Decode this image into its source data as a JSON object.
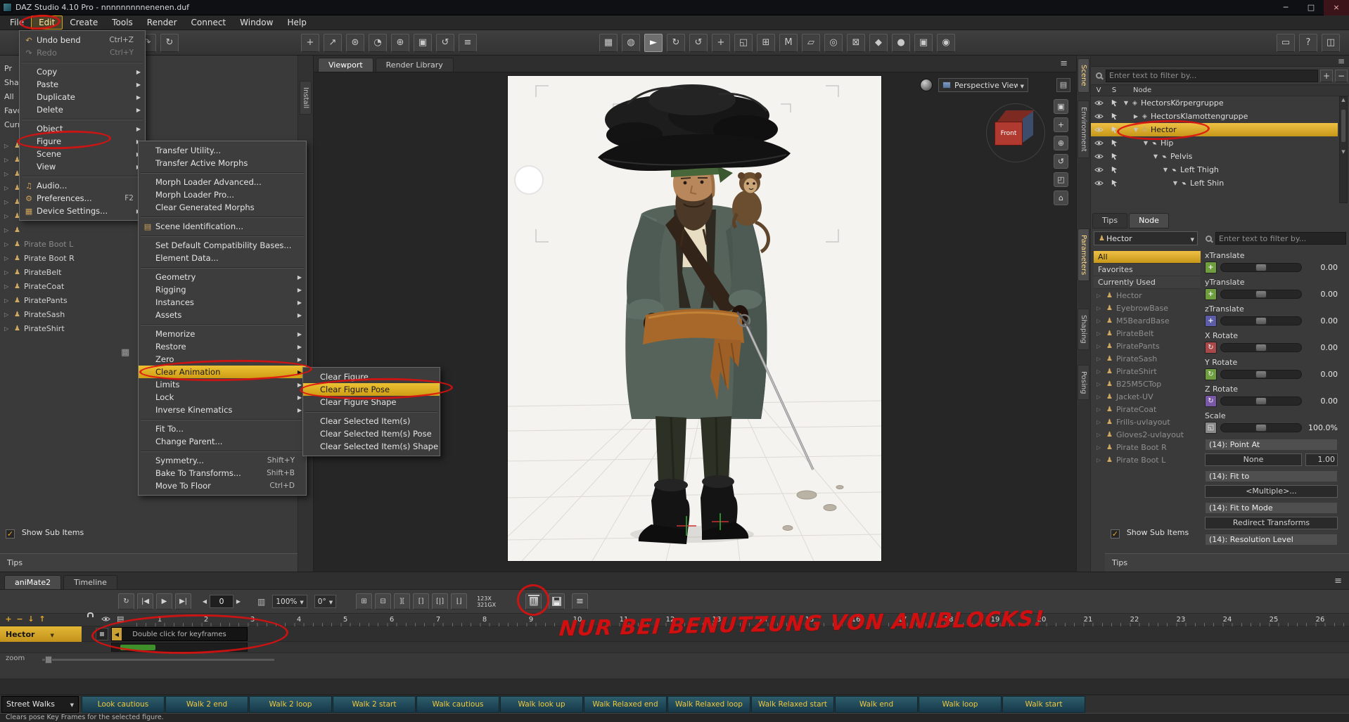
{
  "window": {
    "title": "DAZ Studio 4.10 Pro - nnnnnnnnnenenen.duf",
    "minimize": "─",
    "maximize": "□",
    "close": "×"
  },
  "menu_bar": {
    "items": [
      {
        "label": "File"
      },
      {
        "label": "Edit",
        "active": true
      },
      {
        "label": "Create"
      },
      {
        "label": "Tools"
      },
      {
        "label": "Render"
      },
      {
        "label": "Connect"
      },
      {
        "label": "Window"
      },
      {
        "label": "Help"
      }
    ]
  },
  "edit_menu": {
    "items": [
      {
        "label": "Undo bend",
        "shortcut": "Ctrl+Z",
        "icon": "↶"
      },
      {
        "label": "Redo",
        "shortcut": "Ctrl+Y",
        "icon": "↷",
        "disabled": true
      },
      {
        "label": "Copy",
        "submenu": true,
        "sep": true
      },
      {
        "label": "Paste",
        "submenu": true
      },
      {
        "label": "Duplicate",
        "submenu": true
      },
      {
        "label": "Delete",
        "submenu": true
      },
      {
        "label": "Object",
        "submenu": true,
        "sep": true
      },
      {
        "label": "Figure",
        "submenu": true
      },
      {
        "label": "Scene",
        "submenu": true
      },
      {
        "label": "View",
        "submenu": true
      },
      {
        "label": "Audio...",
        "icon": "♫",
        "sep": true
      },
      {
        "label": "Preferences...",
        "shortcut": "F2",
        "icon": "⚙"
      },
      {
        "label": "Device Settings...",
        "submenu": true,
        "icon": "▦"
      }
    ]
  },
  "figure_menu": {
    "items": [
      {
        "label": "Transfer Utility..."
      },
      {
        "label": "Transfer Active Morphs"
      },
      {
        "label": "Morph Loader Advanced...",
        "sep": true
      },
      {
        "label": "Morph Loader Pro..."
      },
      {
        "label": "Clear Generated Morphs"
      },
      {
        "label": "Scene Identification...",
        "icon": "▤",
        "sep": true
      },
      {
        "label": "Set Default Compatibility Bases...",
        "sep": true
      },
      {
        "label": "Element Data..."
      },
      {
        "label": "Geometry",
        "submenu": true,
        "sep": true
      },
      {
        "label": "Rigging",
        "submenu": true
      },
      {
        "label": "Instances",
        "submenu": true
      },
      {
        "label": "Assets",
        "submenu": true
      },
      {
        "label": "Memorize",
        "submenu": true,
        "sep": true
      },
      {
        "label": "Restore",
        "submenu": true
      },
      {
        "label": "Zero",
        "submenu": true
      },
      {
        "label": "Clear Animation",
        "submenu": true,
        "highlighted": true
      },
      {
        "label": "Limits",
        "submenu": true
      },
      {
        "label": "Lock",
        "submenu": true
      },
      {
        "label": "Inverse Kinematics",
        "submenu": true
      },
      {
        "label": "Fit To...",
        "sep": true
      },
      {
        "label": "Change Parent..."
      },
      {
        "label": "Symmetry...",
        "shortcut": "Shift+Y",
        "sep": true
      },
      {
        "label": "Bake To Transforms...",
        "shortcut": "Shift+B"
      },
      {
        "label": "Move To Floor",
        "shortcut": "Ctrl+D"
      }
    ]
  },
  "clear_animation_menu": {
    "items": [
      {
        "label": "Clear Figure"
      },
      {
        "label": "Clear Figure Pose",
        "highlighted": true
      },
      {
        "label": "Clear Figure Shape"
      },
      {
        "label": "Clear Selected Item(s)",
        "sep": true
      },
      {
        "label": "Clear Selected Item(s) Pose"
      },
      {
        "label": "Clear Selected Item(s) Shape"
      }
    ]
  },
  "toolbar": {
    "group1": [
      {
        "name": "file-icon",
        "glyph": "▢"
      },
      {
        "name": "undo-icon",
        "glyph": "↶"
      },
      {
        "name": "redo-icon",
        "glyph": "↷"
      },
      {
        "name": "refresh-icon",
        "glyph": "↻"
      }
    ],
    "group2": [
      {
        "name": "add-node-icon",
        "glyph": "+"
      },
      {
        "name": "transfer-node-icon",
        "glyph": "↗"
      },
      {
        "name": "starburst-icon",
        "glyph": "⊛"
      },
      {
        "name": "timer-icon",
        "glyph": "◔"
      },
      {
        "name": "target-icon",
        "glyph": "⊕"
      },
      {
        "name": "package-icon",
        "glyph": "▣"
      },
      {
        "name": "rotate-cube-icon",
        "glyph": "↺"
      },
      {
        "name": "list-icon",
        "glyph": "≡"
      }
    ],
    "group3": [
      {
        "name": "grid-tool-icon",
        "glyph": "▦"
      },
      {
        "name": "globe-tool-icon",
        "glyph": "◍"
      },
      {
        "name": "node-select-tool-icon",
        "glyph": "►",
        "active": true
      },
      {
        "name": "rotate-tool-icon",
        "glyph": "↻"
      },
      {
        "name": "twist-tool-icon",
        "glyph": "↺"
      },
      {
        "name": "translate-tool-icon",
        "glyph": "+"
      },
      {
        "name": "scale-tool-icon",
        "glyph": "◱"
      },
      {
        "name": "ik-chain-tool-icon",
        "glyph": "⊞"
      },
      {
        "name": "surface-tool-icon",
        "glyph": "M"
      },
      {
        "name": "geometry-editor-icon",
        "glyph": "▱"
      },
      {
        "name": "figure-pair-icon",
        "glyph": "◎"
      },
      {
        "name": "camera-cube-icon",
        "glyph": "⊠"
      },
      {
        "name": "spray-tool-icon",
        "glyph": "◆"
      },
      {
        "name": "sphere-tool-icon",
        "glyph": "●"
      },
      {
        "name": "camera-tool-icon",
        "glyph": "▣"
      },
      {
        "name": "render-camera-icon",
        "glyph": "◉"
      }
    ],
    "group4": [
      {
        "name": "display-icon",
        "glyph": "▭"
      },
      {
        "name": "help-icon",
        "glyph": "?"
      },
      {
        "name": "layout-icon",
        "glyph": "◫"
      }
    ]
  },
  "left_panel": {
    "clipped_labels": [
      "Pr",
      "Shad",
      "All",
      "Favorites",
      "Currently Used"
    ],
    "items": [
      {
        "label": "Pirate Boot L",
        "dim": true
      },
      {
        "label": "Pirate Boot R"
      },
      {
        "label": "PirateBelt"
      },
      {
        "label": "PirateCoat"
      },
      {
        "label": "PiratePants"
      },
      {
        "label": "PirateSash"
      },
      {
        "label": "PirateShirt"
      }
    ],
    "show_sub_items": "Show Sub Items",
    "tips_label": "Tips",
    "vertical_tab": "Install"
  },
  "viewport": {
    "tabs": [
      {
        "label": "Viewport",
        "active": true
      },
      {
        "label": "Render Library"
      }
    ],
    "view_selector": "Perspective View",
    "cube_face": "Front",
    "nav_icons": [
      {
        "name": "camera-cube-icon",
        "glyph": "▣"
      },
      {
        "name": "camera-pan-icon",
        "glyph": "+"
      },
      {
        "name": "camera-zoom-icon",
        "glyph": "⊕"
      },
      {
        "name": "camera-rotate-icon",
        "glyph": "↺"
      },
      {
        "name": "camera-frame-icon",
        "glyph": "◰"
      },
      {
        "name": "camera-home-icon",
        "glyph": "⌂"
      }
    ]
  },
  "scene_panel": {
    "vertical_tabs": [
      {
        "label": "Scene",
        "active": true
      },
      {
        "label": "Environment"
      }
    ],
    "filter_placeholder": "Enter text to filter by...",
    "columns": {
      "v": "V",
      "s": "S",
      "node": "Node"
    },
    "rows": [
      {
        "label": "HectorsKörpergruppe",
        "indent": 0,
        "expander": "▼",
        "icon": "group"
      },
      {
        "label": "HectorsKlamottengruppe",
        "indent": 1,
        "expander": "▶",
        "icon": "group"
      },
      {
        "label": "Hector",
        "indent": 1,
        "expander": "▼",
        "icon": "figure",
        "selected": true
      },
      {
        "label": "Hip",
        "indent": 2,
        "expander": "▼",
        "icon": "bone"
      },
      {
        "label": "Pelvis",
        "indent": 3,
        "expander": "▼",
        "icon": "bone"
      },
      {
        "label": "Left Thigh",
        "indent": 4,
        "expander": "▼",
        "icon": "bone"
      },
      {
        "label": "Left Shin",
        "indent": 5,
        "expander": "▼",
        "icon": "bone"
      }
    ]
  },
  "parameters_panel": {
    "tabs": [
      {
        "label": "Tips"
      },
      {
        "label": "Node",
        "active": true
      }
    ],
    "vertical_tabs": [
      {
        "label": "Parameters",
        "active": true
      },
      {
        "label": "Shaping"
      },
      {
        "label": "Posing"
      }
    ],
    "node_selector": "Hector",
    "filter_placeholder": "Enter text to filter by...",
    "groups": [
      {
        "label": "All",
        "selected": true
      },
      {
        "label": "Favorites"
      },
      {
        "label": "Currently Used"
      }
    ],
    "nodes": [
      "Hector",
      "EyebrowBase",
      "M5BeardBase",
      "PirateBelt",
      "PiratePants",
      "PirateSash",
      "PirateShirt",
      "B25M5CTop",
      "Jacket-UV",
      "PirateCoat",
      "Frills-uvlayout",
      "Gloves2-uvlayout",
      "Pirate Boot R",
      "Pirate Boot L"
    ],
    "sliders": [
      {
        "label": "xTranslate",
        "value": "0.00",
        "kind": "translate",
        "color": "#6f9e3e"
      },
      {
        "label": "yTranslate",
        "value": "0.00",
        "kind": "translate",
        "color": "#6f9e3e"
      },
      {
        "label": "zTranslate",
        "value": "0.00",
        "kind": "translate",
        "color": "#5c5ca8"
      },
      {
        "label": "X Rotate",
        "value": "0.00",
        "kind": "rotate",
        "color": "#a84848"
      },
      {
        "label": "Y Rotate",
        "value": "0.00",
        "kind": "rotate",
        "color": "#6f9e3e"
      },
      {
        "label": "Z Rotate",
        "value": "0.00",
        "kind": "rotate",
        "color": "#7a58a8"
      },
      {
        "label": "Scale",
        "value": "100.0%",
        "kind": "scale",
        "color": "#8a8a8a"
      }
    ],
    "point_at": {
      "header": "(14): Point At",
      "value": "None",
      "number": "1.00"
    },
    "fit_to": {
      "header": "(14): Fit to",
      "value": "<Multiple>..."
    },
    "fit_to_mode": {
      "header": "(14): Fit to Mode",
      "value": "Redirect Transforms"
    },
    "resolution": {
      "header": "(14): Resolution Level"
    },
    "show_sub_items": "Show Sub Items",
    "tips_label": "Tips"
  },
  "timeline": {
    "tabs": [
      {
        "label": "aniMate2",
        "active": true
      },
      {
        "label": "Timeline"
      }
    ],
    "transport": [
      {
        "name": "loop-playback-icon",
        "glyph": "↻"
      },
      {
        "name": "go-to-start-icon",
        "glyph": "|◀"
      },
      {
        "name": "play-icon",
        "glyph": "▶"
      },
      {
        "name": "go-to-end-icon",
        "glyph": "▶|"
      }
    ],
    "frame_value": "0",
    "speed": "100%",
    "angle": "0°",
    "edit_icons": [
      {
        "name": "expand-keys-icon",
        "glyph": "⊞"
      },
      {
        "name": "collapse-keys-icon",
        "glyph": "⊟"
      },
      {
        "name": "trim-start-icon",
        "glyph": "]["
      },
      {
        "name": "trim-end-icon",
        "glyph": "[]"
      },
      {
        "name": "loop-range-icon",
        "glyph": "[|]"
      },
      {
        "name": "frame-range-icon",
        "glyph": "⌊⌋"
      }
    ],
    "badge_top": "123X",
    "badge_bottom": "321GX",
    "track_tools": [
      {
        "name": "add-track-icon",
        "glyph": "+"
      },
      {
        "name": "remove-track-icon",
        "glyph": "−"
      },
      {
        "name": "move-track-down-icon",
        "glyph": "↓"
      },
      {
        "name": "move-track-up-icon",
        "glyph": "↑"
      }
    ],
    "ruler": [
      "1",
      "2",
      "3",
      "4",
      "5",
      "6",
      "7",
      "8",
      "9",
      "10",
      "11",
      "12",
      "13",
      "14",
      "15",
      "16",
      "17",
      "18",
      "19",
      "20",
      "21",
      "22",
      "23",
      "24",
      "25",
      "26"
    ],
    "track_name": "Hector",
    "keyframe_hint": "Double click for keyframes",
    "zoom_label": "zoom"
  },
  "aniblocks": {
    "category": "Street Walks",
    "blocks": [
      "Look cautious",
      "Walk 2 end",
      "Walk 2 loop",
      "Walk 2 start",
      "Walk cautious",
      "Walk look up",
      "Walk Relaxed end",
      "Walk Relaxed loop",
      "Walk Relaxed start",
      "Walk end",
      "Walk loop",
      "Walk start"
    ]
  },
  "status_bar": {
    "text": "Clears pose Key Frames for the selected figure."
  },
  "annotations": {
    "note": "NUR BEI BENUTZUNG VON ANIBLOCKS!"
  },
  "colors": {
    "selection_gold": "#d9a41e",
    "annotation_red": "#de1010",
    "aniblock_text": "#eec83f"
  }
}
